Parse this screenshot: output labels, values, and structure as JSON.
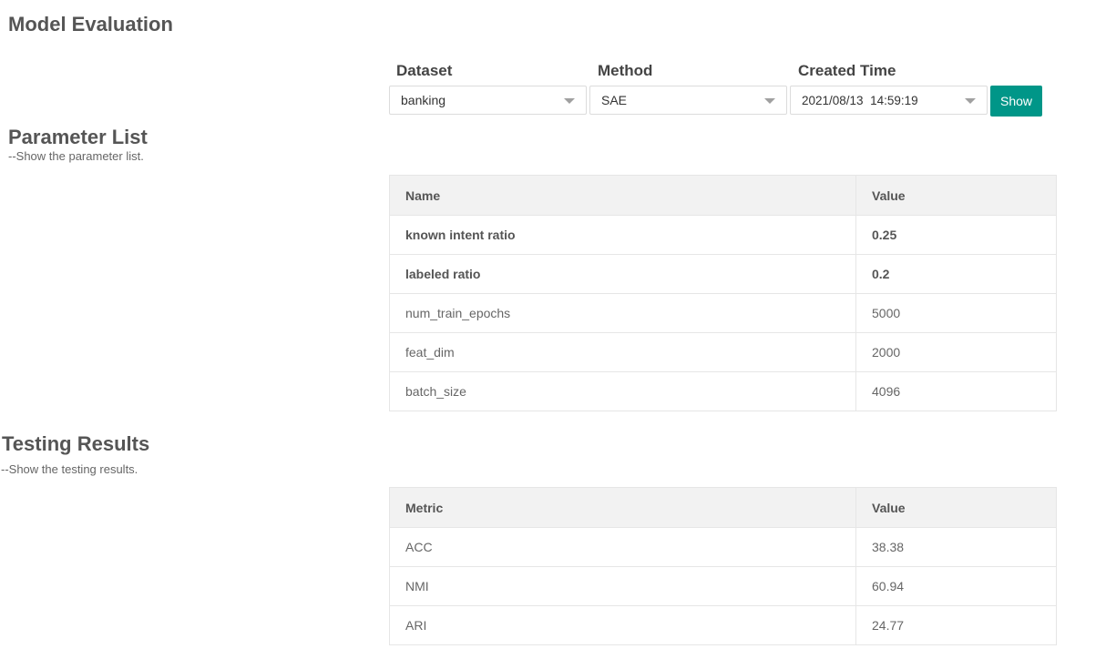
{
  "page_title": "Model Evaluation",
  "filters": {
    "dataset": {
      "label": "Dataset",
      "value": "banking"
    },
    "method": {
      "label": "Method",
      "value": "SAE"
    },
    "created_time": {
      "label": "Created Time",
      "value": "2021/08/13  14:59:19"
    },
    "show_label": "Show",
    "button_color": "#009688"
  },
  "parameter_list": {
    "title": "Parameter List",
    "subtitle": "--Show the parameter list.",
    "headers": [
      "Name",
      "Value"
    ],
    "rows": [
      {
        "name": "known intent ratio",
        "value": "0.25",
        "bold": true
      },
      {
        "name": "labeled ratio",
        "value": "0.2",
        "bold": true
      },
      {
        "name": "num_train_epochs",
        "value": "5000",
        "bold": false
      },
      {
        "name": "feat_dim",
        "value": "2000",
        "bold": false
      },
      {
        "name": "batch_size",
        "value": "4096",
        "bold": false
      }
    ]
  },
  "testing_results": {
    "title": "Testing Results",
    "subtitle": "--Show the testing results.",
    "headers": [
      "Metric",
      "Value"
    ],
    "rows": [
      {
        "metric": "ACC",
        "value": "38.38"
      },
      {
        "metric": "NMI",
        "value": "60.94"
      },
      {
        "metric": "ARI",
        "value": "24.77"
      }
    ]
  }
}
